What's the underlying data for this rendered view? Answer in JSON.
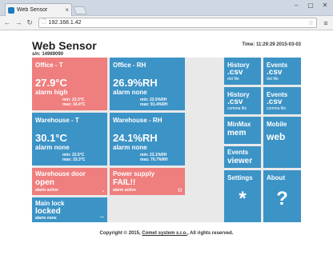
{
  "browser": {
    "tab_title": "Web Sensor",
    "tab_close": "×",
    "window_controls": [
      "–",
      "▢",
      "✕"
    ],
    "url": "192.168.1.42",
    "nav_icons": [
      "arrow-left-icon",
      "arrow-right-icon",
      "reload-icon"
    ],
    "back": "←",
    "forward": "→",
    "reload": "↻",
    "star": "☆",
    "menu": "≡",
    "page_icon": "🗋"
  },
  "header": {
    "title": "Web Sensor",
    "serial": "s/n: 14969090",
    "time": "Time: 11:29:29 2015-03-03"
  },
  "tiles": {
    "office_t": {
      "title": "Office - T",
      "value": "27.9°C",
      "status": "alarm high",
      "min": "min: 23.3°C",
      "max": "max: 34.4°C",
      "color": "#ef7e7e"
    },
    "office_rh": {
      "title": "Office - RH",
      "value": "26.9%RH",
      "status": "alarm none",
      "min": "min: 22.5%RH",
      "max": "max: 91.4%RH",
      "color": "#3c93c6"
    },
    "warehouse_t": {
      "title": "Warehouse - T",
      "value": "30.1°C",
      "status": "alarm none",
      "min": "min: 22.5°C",
      "max": "max: 33.3°C"
    },
    "warehouse_rh": {
      "title": "Warehouse - RH",
      "value": "24.1%RH",
      "status": "alarm none",
      "min": "min: 22.1%RH",
      "max": "max: 70.7%RH"
    },
    "warehouse_door": {
      "title": "Warehouse door",
      "text": "open",
      "note": "alarm active",
      "corner": "⌟"
    },
    "power_supply": {
      "title": "Power supply",
      "text": "FAIL!!",
      "note": "alarm active",
      "corner": "⌊⌋"
    },
    "main_lock": {
      "title": "Main lock",
      "text": "locked",
      "note": "alarm none",
      "corner": "—"
    }
  },
  "sidebar": {
    "history_dot": {
      "title": "History",
      "big": ".csv",
      "sub": "dot file"
    },
    "events_dot": {
      "title": "Events",
      "big": ".csv",
      "sub": "dot file"
    },
    "history_comma": {
      "title": "History",
      "big": ".csv",
      "sub": "comma file"
    },
    "events_comma": {
      "title": "Events",
      "big": ".csv",
      "sub": "comma file"
    },
    "minmax": {
      "title": "MinMax",
      "big": "mem"
    },
    "mobile": {
      "title": "Mobile",
      "big": "web"
    },
    "events_viewer": {
      "title": "Events",
      "big": "viewer"
    },
    "settings": {
      "title": "Settings",
      "glyph": "*"
    },
    "about": {
      "title": "About",
      "glyph": "?"
    }
  },
  "footer": {
    "prefix": "Copyright © 2015,",
    "link": "Comet system s.r.o.",
    "suffix": "All rights reserved."
  },
  "colors": {
    "blue": "#3c93c6",
    "red": "#ef7e7e",
    "grid": "#e9e9e9"
  }
}
